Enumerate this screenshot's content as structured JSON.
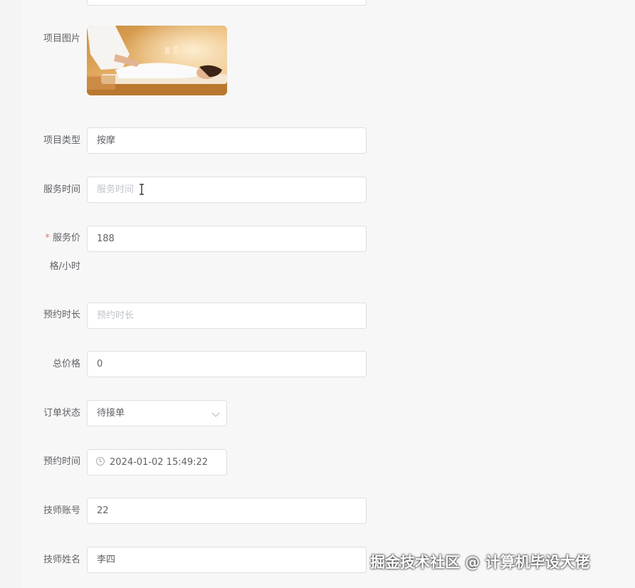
{
  "form": {
    "image_label": "项目图片",
    "type_label": "项目类型",
    "type_value": "按摩",
    "service_time_label": "服务时间",
    "service_time_placeholder": "服务时间",
    "price_label_line1": "服务价",
    "price_label_line2": "格/小时",
    "price_required_mark": "*",
    "price_value": "188",
    "duration_label": "预约时长",
    "duration_placeholder": "预约时长",
    "total_label": "总价格",
    "total_value": "0",
    "status_label": "订单状态",
    "status_value": "待接单",
    "appt_time_label": "预约时间",
    "appt_time_value": "2024-01-02 15:49:22",
    "tech_account_label": "技师账号",
    "tech_account_value": "22",
    "tech_name_label": "技师姓名",
    "tech_name_value": "李四"
  },
  "watermark": "掘金技术社区 @ 计算机毕设大佬",
  "icons": {
    "select": "chevron-down-icon",
    "datetime": "clock-icon",
    "cursor": "text-cursor-icon"
  }
}
